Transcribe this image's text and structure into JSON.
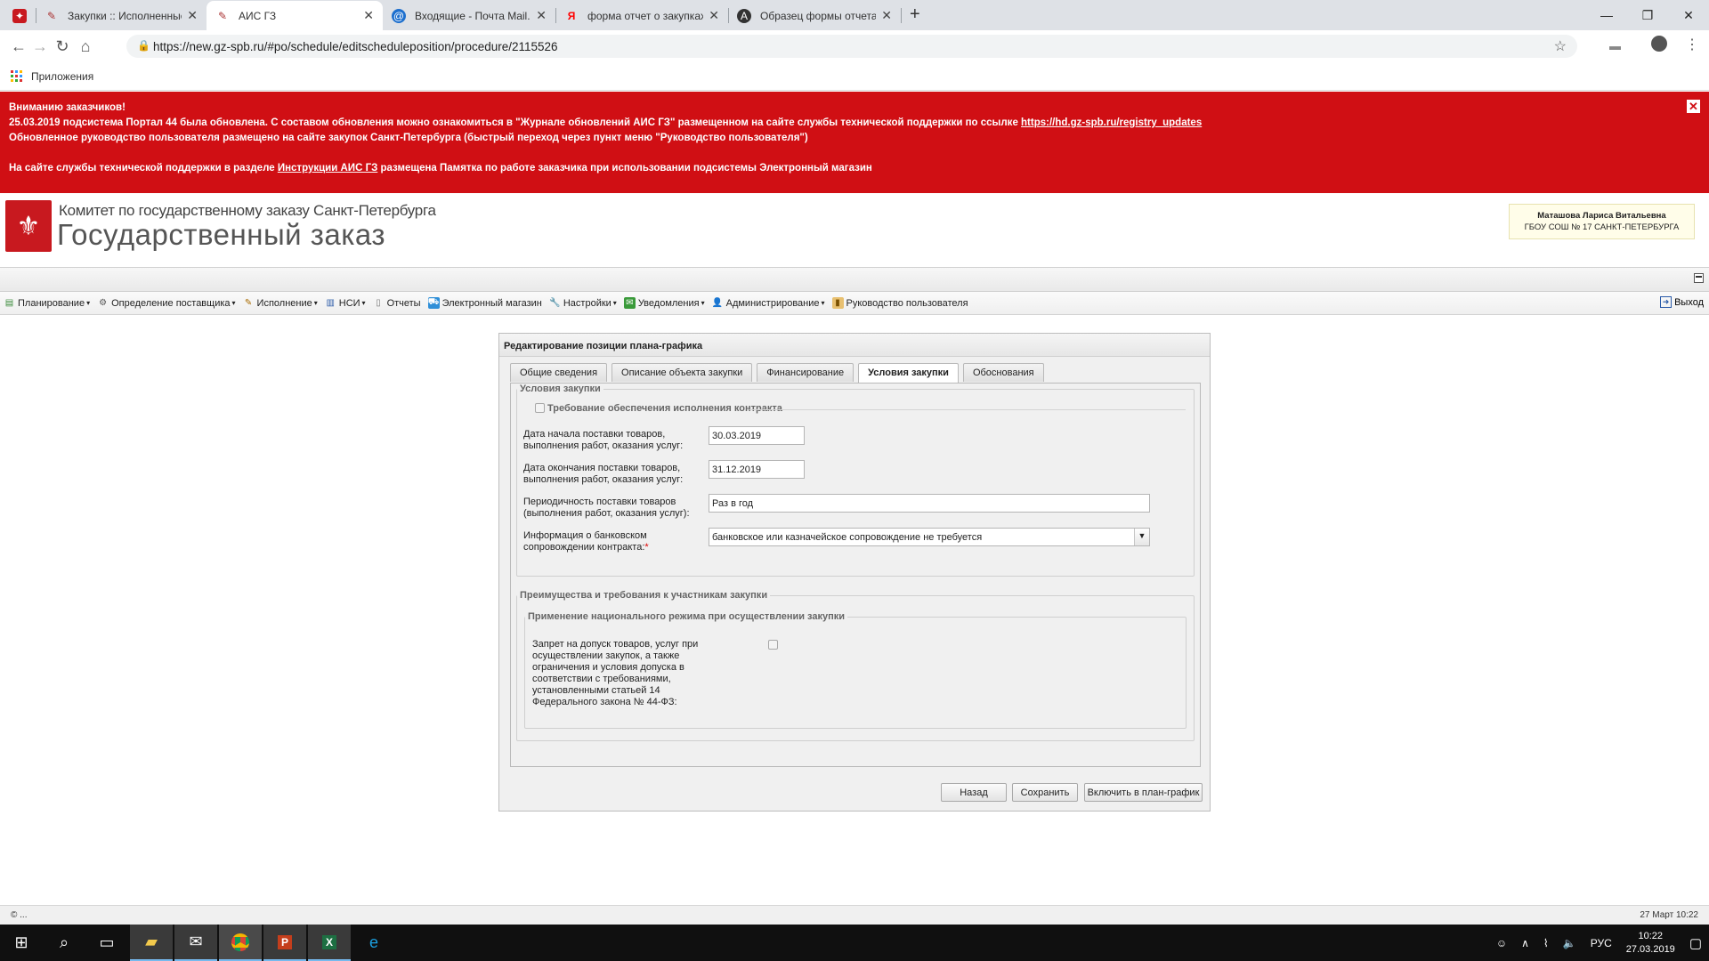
{
  "browser": {
    "tabs": [
      {
        "title": "",
        "favicon": "spb-crest-icon",
        "active": false
      },
      {
        "title": "Закупки :: Исполненные контра",
        "favicon": "gz-icon",
        "active": false
      },
      {
        "title": "АИС ГЗ",
        "favicon": "gz-icon",
        "active": true
      },
      {
        "title": "Входящие - Почта Mail.Ru",
        "favicon": "mail-icon",
        "active": false
      },
      {
        "title": "форма отчет о закупках у смп з",
        "favicon": "yandex-icon",
        "active": false
      },
      {
        "title": "Образец формы отчета смп по",
        "favicon": "doc-icon",
        "active": false
      }
    ],
    "url": "https://new.gz-spb.ru/#po/schedule/editscheduleposition/procedure/2115526",
    "bookmarks_label": "Приложения"
  },
  "notice": {
    "line1": "Вниманию заказчиков!",
    "line2": "25.03.2019 подсистема Портал 44 была обновлена. С составом обновления можно ознакомиться в \"Журнале обновлений АИС ГЗ\" размещенном на сайте службы технической поддержки по ссылке ",
    "line2_link": "https://hd.gz-spb.ru/registry_updates",
    "line3": "Обновленное руководство пользователя размещено на сайте закупок Санкт-Петербурга (быстрый переход через пункт меню \"Руководство пользователя\")",
    "line4_pre": "На сайте службы технической поддержки в разделе ",
    "line4_link": "Инструкции АИС ГЗ",
    "line4_post": " размещена Памятка по работе заказчика при использовании подсистемы Электронный магазин"
  },
  "header": {
    "org_line1": "Комитет по государственному заказу Санкт-Петербурга",
    "org_line2": "Государственный заказ",
    "user_name": "Маташова Лариса Витальевна",
    "user_org": "ГБОУ СОШ № 17 САНКТ-ПЕТЕРБУРГА"
  },
  "menu": {
    "items": [
      {
        "label": "Планирование",
        "dropdown": true
      },
      {
        "label": "Определение поставщика",
        "dropdown": true
      },
      {
        "label": "Исполнение",
        "dropdown": true
      },
      {
        "label": "НСИ",
        "dropdown": true
      },
      {
        "label": "Отчеты",
        "dropdown": false
      },
      {
        "label": "Электронный магазин",
        "dropdown": false
      },
      {
        "label": "Настройки",
        "dropdown": true
      },
      {
        "label": "Уведомления",
        "dropdown": true
      },
      {
        "label": "Администрирование",
        "dropdown": true
      },
      {
        "label": "Руководство пользователя",
        "dropdown": false
      }
    ],
    "exit": "Выход"
  },
  "dialog": {
    "title": "Редактирование позиции плана-графика",
    "tabs": [
      "Общие сведения",
      "Описание объекта закупки",
      "Финансирование",
      "Условия закупки",
      "Обоснования"
    ],
    "active_tab": "Условия закупки",
    "conditions": {
      "legend": "Условия закупки",
      "guarantee_label": "Требование обеспечения исполнения контракта",
      "start_label": "Дата начала поставки товаров, выполнения работ, оказания услуг:",
      "start_value": "30.03.2019",
      "end_label": "Дата окончания поставки товаров, выполнения работ, оказания услуг:",
      "end_value": "31.12.2019",
      "period_label": "Периодичность поставки товаров (выполнения работ, оказания услуг):",
      "period_value": "Раз в год",
      "bank_label": "Информация о банковском сопровождении контракта:",
      "bank_required": "*",
      "bank_value": "банковское или казначейское сопровождение не требуется"
    },
    "advantages": {
      "legend": "Преимущества и требования к участникам закупки",
      "national_legend": "Применение национального режима при осуществлении закупки",
      "ban_label": "Запрет на допуск товаров, услуг при осуществлении закупок, а также ограничения и условия допуска в соответствии с требованиями, установленными статьей 14 Федерального закона № 44-ФЗ:"
    },
    "buttons": {
      "back": "Назад",
      "save": "Сохранить",
      "include": "Включить в план-график"
    }
  },
  "status": {
    "left": "© ...",
    "right": "27 Март 10:22"
  },
  "taskbar": {
    "lang": "РУС",
    "time": "10:22",
    "date": "27.03.2019"
  }
}
